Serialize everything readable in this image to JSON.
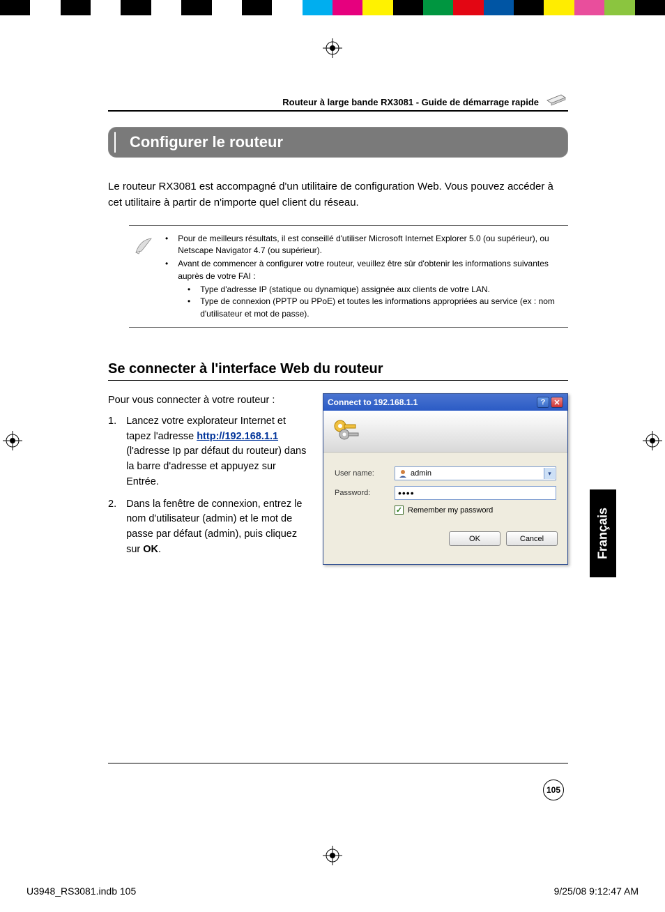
{
  "colorbar": [
    "#000000",
    "#ffffff",
    "#000000",
    "#ffffff",
    "#000000",
    "#ffffff",
    "#000000",
    "#ffffff",
    "#000000",
    "#ffffff",
    "#00aeef",
    "#e6007e",
    "#fff200",
    "#000000",
    "#009640",
    "#e30613",
    "#0055a4",
    "#000000",
    "#ffed00",
    "#e94e9c",
    "#8bc53f",
    "#000000"
  ],
  "header": "Routeur à large bande RX3081 - Guide de démarrage rapide",
  "title": "Configurer le routeur",
  "intro": "Le routeur RX3081 est accompagné d'un utilitaire de configuration Web. Vous pouvez accéder à cet utilitaire à partir de n'importe quel client du réseau.",
  "note": {
    "b1": "Pour de meilleurs résultats, il est conseillé d'utiliser Microsoft Internet Explorer 5.0 (ou supérieur), ou Netscape Navigator 4.7 (ou supérieur).",
    "b2": "Avant de commencer à configurer votre routeur, veuillez être sûr d'obtenir les informations suivantes auprès de votre FAI :",
    "s1": "Type d'adresse IP (statique ou dynamique) assignée aux clients de votre LAN.",
    "s2": "Type de connexion (PPTP ou PPoE) et toutes les informations appropriées au service (ex : nom d'utilisateur et mot de passe)."
  },
  "section_h": "Se connecter à l'interface Web du routeur",
  "lead": "Pour vous connecter à votre routeur :",
  "step1_pre": "Lancez votre explorateur Internet et tapez l'adresse ",
  "step1_link": "http://192.168.1.1",
  "step1_post": " (l'adresse Ip par défaut du routeur) dans la barre d'adresse et appuyez sur Entrée.",
  "step2_pre": "Dans la fenêtre de connexion, entrez le nom d'utilisateur (admin) et le mot de passe par défaut (admin), puis cliquez sur ",
  "step2_bold": "OK",
  "step2_post": ".",
  "dialog": {
    "title": "Connect to 192.168.1.1",
    "help": "?",
    "close": "✕",
    "user_label": "User name:",
    "user_value": "admin",
    "pass_label": "Password:",
    "pass_value": "••••",
    "remember": "Remember my password",
    "ok": "OK",
    "cancel": "Cancel"
  },
  "lang": "Français",
  "page_num": "105",
  "footer_left": "U3948_RS3081.indb   105",
  "footer_right": "9/25/08   9:12:47 AM"
}
